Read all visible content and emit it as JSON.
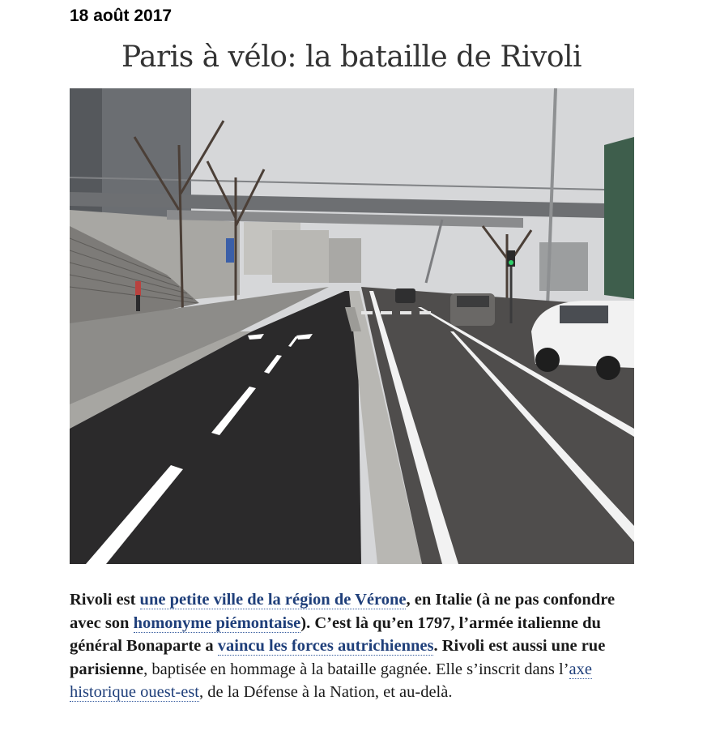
{
  "post": {
    "date": "18 août 2017",
    "title": "Paris à vélo: la bataille de Rivoli",
    "photo_alt": "Piste cyclable le long d'une avenue parisienne sous une passerelle"
  },
  "article": {
    "t1": "Rivoli est ",
    "link1": "une petite ville de la région de Vérone",
    "t2": ", en Italie (à ne pas confondre avec son ",
    "link2": "homonyme piémontaise",
    "t3": "). C’est là qu’en 1797, l’armée italienne du général Bonaparte a ",
    "link3": "vaincu les forces autrichiennes",
    "t4": ". Rivoli est aussi une rue parisienne",
    "t5": ", baptisée en hommage à la bataille gagnée. Elle s’inscrit dans l’",
    "link4": "axe historique ouest-est",
    "t6": ", de la Défense à la Nation, et au-delà."
  }
}
